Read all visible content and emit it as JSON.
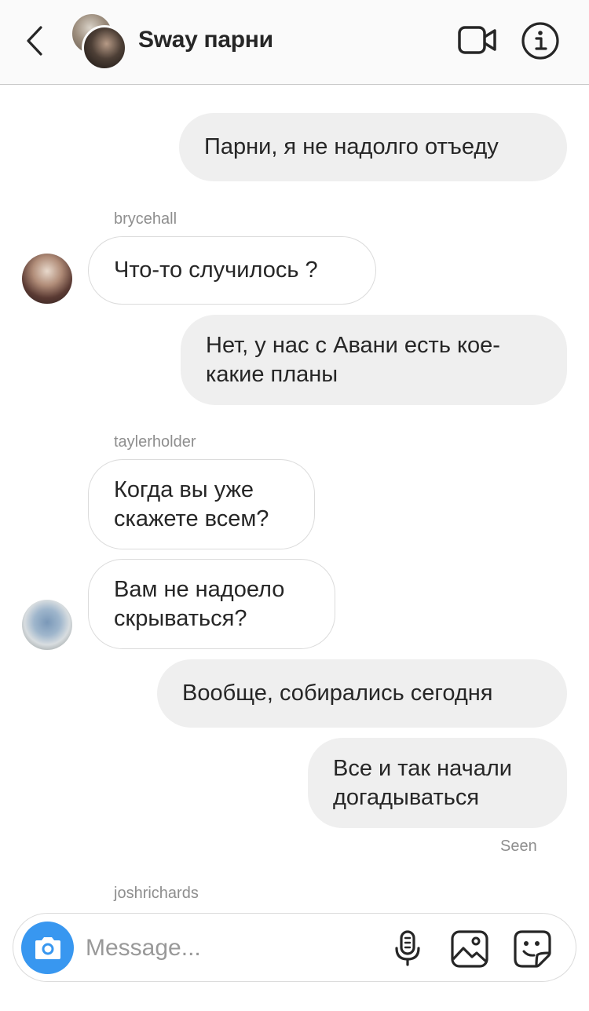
{
  "header": {
    "title": "Sway парни",
    "icons": [
      "back-chevron-icon",
      "video-camera-icon",
      "info-icon"
    ]
  },
  "messages": [
    {
      "direction": "outgoing",
      "text": "Парни, я не надолго отъеду"
    },
    {
      "direction": "incoming",
      "sender": "brycehall",
      "text": "Что-то случилось ?"
    },
    {
      "direction": "outgoing",
      "text": "Нет, у нас с Авани есть кое-какие планы"
    },
    {
      "direction": "incoming",
      "sender": "taylerholder",
      "text": "Когда вы уже скажете всем?"
    },
    {
      "direction": "incoming",
      "sender": "taylerholder",
      "text": "Вам не надоело скрываться?"
    },
    {
      "direction": "outgoing",
      "text": "Вообще, собирались сегодня"
    },
    {
      "direction": "outgoing",
      "text": "Все и так начали догадываться"
    }
  ],
  "status": {
    "seen": "Seen",
    "typing_sender": "joshrichards"
  },
  "composer": {
    "placeholder": "Message...",
    "icons": [
      "camera-icon",
      "microphone-icon",
      "gallery-icon",
      "sticker-icon"
    ],
    "accent_color": "#3897f0"
  }
}
